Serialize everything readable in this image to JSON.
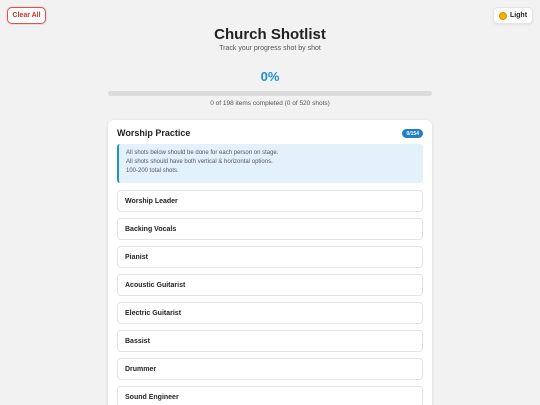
{
  "header": {
    "clear_label": "Clear All",
    "theme_label": "Light",
    "title": "Church Shotlist",
    "subtitle": "Track your progress shot by shot"
  },
  "progress": {
    "percent_label": "0%",
    "fraction": 0,
    "summary": "0 of 198 items completed (0 of 520 shots)"
  },
  "section": {
    "title": "Worship Practice",
    "badge": "0/154",
    "notes": [
      "All shots below should be done for each person on stage.",
      "All shots should have both vertical & horizontal options.",
      "100-200 total shots."
    ],
    "items": [
      "Worship Leader",
      "Backing Vocals",
      "Pianist",
      "Acoustic Guitarist",
      "Electric Guitarist",
      "Bassist",
      "Drummer",
      "Sound Engineer"
    ]
  },
  "colors": {
    "accent": "#1f8fd0",
    "danger": "#c9302c"
  }
}
